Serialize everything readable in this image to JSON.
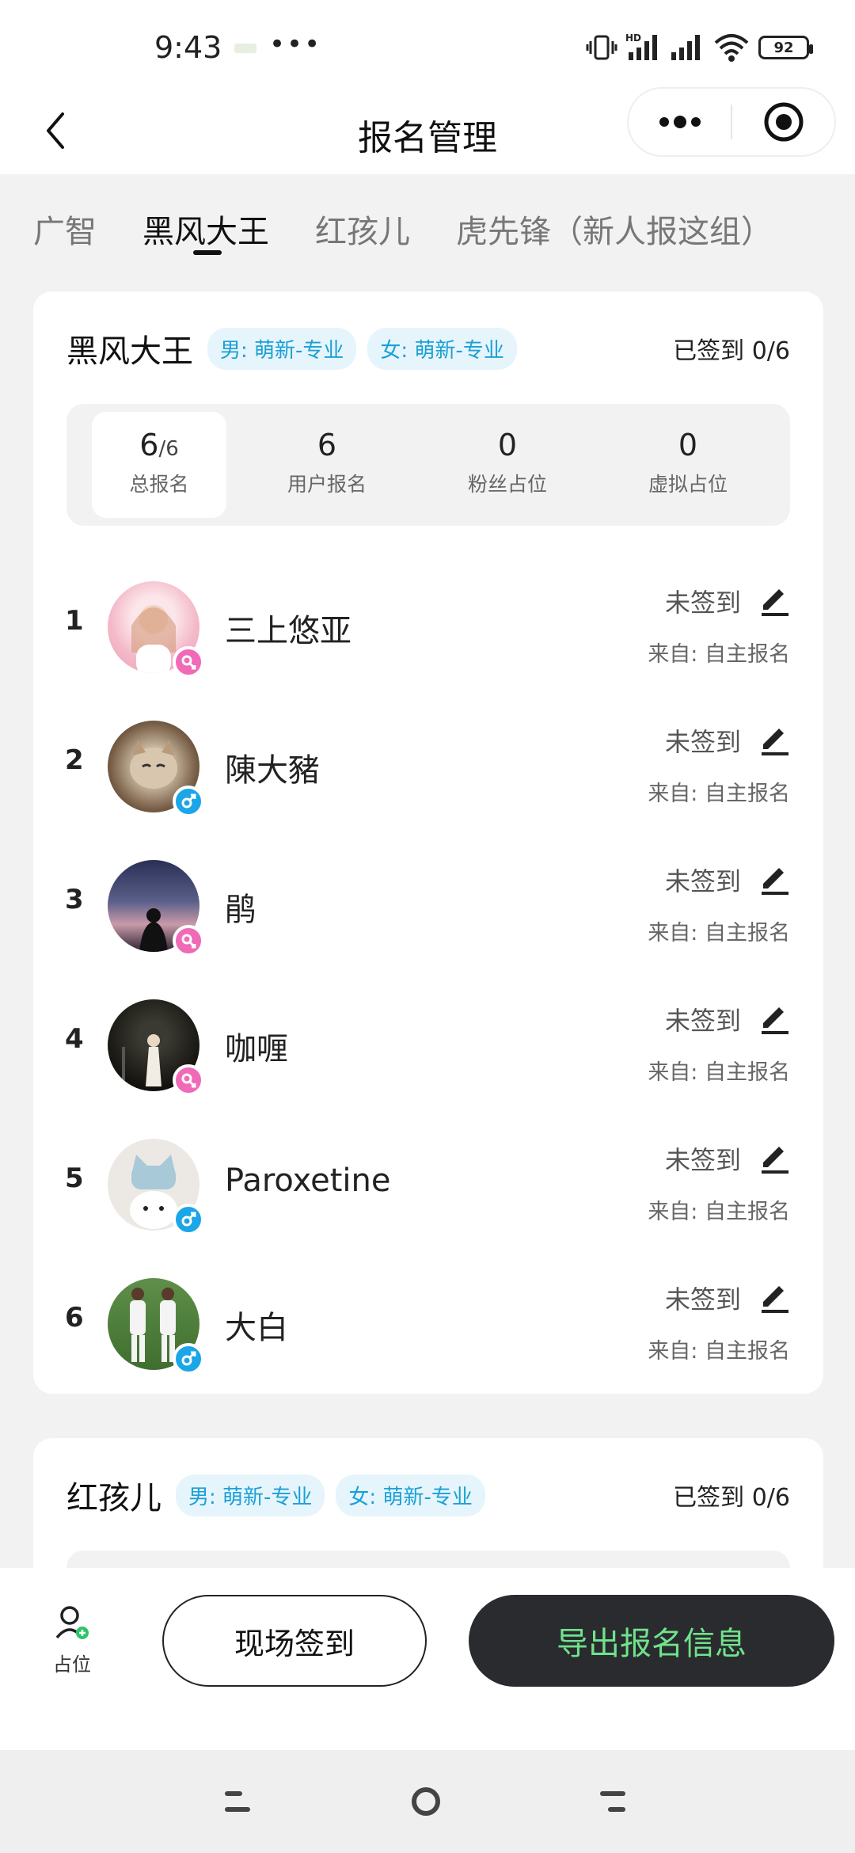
{
  "status_bar": {
    "time": "9:43",
    "dots": "•••",
    "battery": "92",
    "hd_label": "HD"
  },
  "header": {
    "title": "报名管理"
  },
  "tabs": [
    {
      "label": "广智",
      "active": false
    },
    {
      "label": "黑风大王",
      "active": true
    },
    {
      "label": "红孩儿",
      "active": false
    },
    {
      "label": "虎先锋（新人报这组）",
      "active": false
    }
  ],
  "group1": {
    "name": "黑风大王",
    "tags": [
      "男: 萌新-专业",
      "女: 萌新-专业"
    ],
    "checked_in": "已签到 0/6",
    "stats": [
      {
        "num": "6",
        "sub": "/6",
        "label": "总报名"
      },
      {
        "num": "6",
        "sub": "",
        "label": "用户报名"
      },
      {
        "num": "0",
        "sub": "",
        "label": "粉丝占位"
      },
      {
        "num": "0",
        "sub": "",
        "label": "虚拟占位"
      }
    ],
    "members": [
      {
        "index": "1",
        "name": "三上悠亚",
        "gender": "female",
        "status": "未签到",
        "source": "来自: 自主报名"
      },
      {
        "index": "2",
        "name": "陳大豬",
        "gender": "male",
        "status": "未签到",
        "source": "来自: 自主报名"
      },
      {
        "index": "3",
        "name": "鹃",
        "gender": "female",
        "status": "未签到",
        "source": "来自: 自主报名"
      },
      {
        "index": "4",
        "name": "咖喱",
        "gender": "female",
        "status": "未签到",
        "source": "来自: 自主报名"
      },
      {
        "index": "5",
        "name": "Paroxetine",
        "gender": "male",
        "status": "未签到",
        "source": "来自: 自主报名"
      },
      {
        "index": "6",
        "name": "大白",
        "gender": "male",
        "status": "未签到",
        "source": "来自: 自主报名"
      }
    ]
  },
  "group2": {
    "name": "红孩儿",
    "tags": [
      "男: 萌新-专业",
      "女: 萌新-专业"
    ],
    "checked_in": "已签到 0/6"
  },
  "actions": {
    "place_label": "占位",
    "checkin_label": "现场签到",
    "export_label": "导出报名信息"
  },
  "colors": {
    "accent_green": "#6fe38b",
    "tag_blue": "#1aa0d6",
    "female_pink": "#f06ab8",
    "male_blue": "#1aa6e8"
  }
}
